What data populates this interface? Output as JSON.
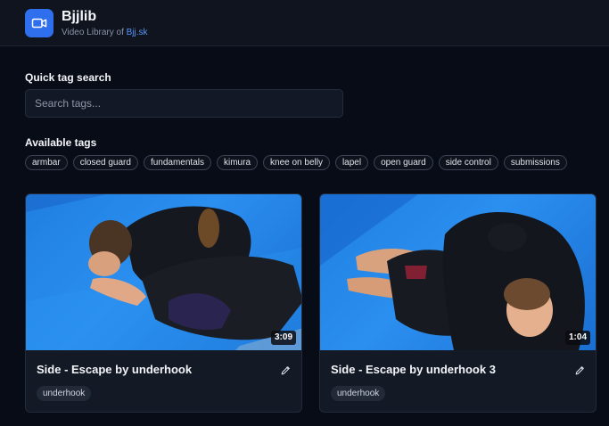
{
  "app": {
    "name": "Bjjlib",
    "subtitle_prefix": "Video Library of ",
    "subtitle_link": "Bjj.sk",
    "logo_icon": "video-camera-icon",
    "accent_color": "#2f6fed"
  },
  "search": {
    "label": "Quick tag search",
    "placeholder": "Search tags...",
    "value": ""
  },
  "tags": {
    "label": "Available tags",
    "items": [
      "armbar",
      "closed guard",
      "fundamentals",
      "kimura",
      "knee on belly",
      "lapel",
      "open guard",
      "side control",
      "submissions"
    ]
  },
  "videos": [
    {
      "title": "Side - Escape by underhook",
      "duration": "3:09",
      "tag": "underhook",
      "edit_icon": "pencil-icon"
    },
    {
      "title": "Side - Escape by underhook 3",
      "duration": "1:04",
      "tag": "underhook",
      "edit_icon": "pencil-icon"
    }
  ]
}
